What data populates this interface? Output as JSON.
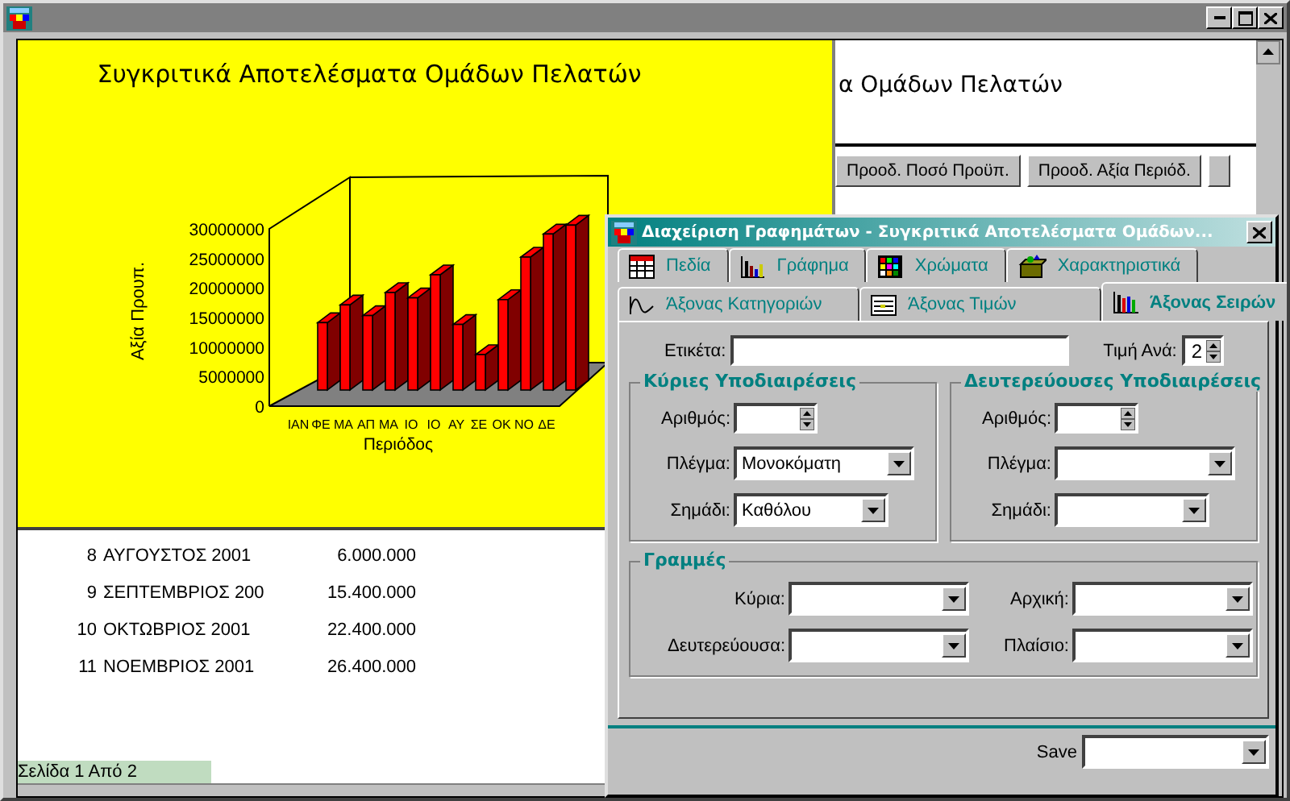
{
  "report": {
    "chart_panel": {
      "title": "Συγκριτικά Αποτελέσματα Ομάδων Πελατών",
      "x_axis_label": "Περιόδος",
      "y_axis_label": "Αξία Προυπ.",
      "x_labels": [
        "ΙΑΝ",
        "ΦΕ",
        "ΜΑ",
        "ΑΠ",
        "ΜΑ",
        "ΙΟ",
        "ΙΟ",
        "ΑΥ",
        "ΣΕ",
        "ΟΚ",
        "ΝΟ",
        "ΔΕ"
      ],
      "y_labels": [
        "30000000",
        "25000000",
        "20000000",
        "15000000",
        "10000000",
        "5000000",
        "0"
      ]
    },
    "header_text": "α Ομάδων Πελατών",
    "column_buttons": [
      "Προοδ. Ποσό Προϋπ.",
      "Προοδ. Αξία Περιόδ."
    ],
    "rows": [
      {
        "number": "8",
        "period": "ΑΥΓΟΥΣΤΟΣ 2001",
        "value": "6.000.000"
      },
      {
        "number": "9",
        "period": "ΣΕΠΤΕΜΒΡΙΟΣ 200",
        "value": "15.400.000"
      },
      {
        "number": "10",
        "period": "ΟΚΤΩΒΡΙΟΣ 2001",
        "value": "22.400.000"
      },
      {
        "number": "11",
        "period": "ΝΟΕΜΒΡΙΟΣ 2001",
        "value": "26.400.000"
      }
    ],
    "status": "Σελίδα 1 Από 2"
  },
  "dialog": {
    "title": "Διαχείριση Γραφημάτων - Συγκριτικά Αποτελέσματα Ομάδων...",
    "tab_rows": [
      [
        {
          "label": "Πεδία",
          "selected": false
        },
        {
          "label": "Γράφημα",
          "selected": false
        },
        {
          "label": "Χρώματα",
          "selected": false
        },
        {
          "label": "Χαρακτηριστικά",
          "selected": false
        }
      ],
      [
        {
          "label": "Άξονας Κατηγοριών",
          "selected": false
        },
        {
          "label": "Άξονας Τιμών",
          "selected": false
        },
        {
          "label": "Άξονας Σειρών",
          "selected": true
        }
      ]
    ],
    "label_field": {
      "label": "Ετικέτα:"
    },
    "step_field": {
      "label": "Τιμή Ανά:",
      "value": "2"
    },
    "groups": [
      {
        "title": "Κύριες Υποδιαιρέσεις",
        "number": {
          "label": "Αριθμός:"
        },
        "grid": {
          "label": "Πλέγμα:",
          "value": "Μονοκόματη"
        },
        "marker": {
          "label": "Σημάδι:",
          "value": "Καθόλου"
        }
      },
      {
        "title": "Δευτερεύουσες Υποδιαιρέσεις",
        "number": {
          "label": "Αριθμός:"
        },
        "grid": {
          "label": "Πλέγμα:"
        },
        "marker": {
          "label": "Σημάδι:"
        }
      }
    ],
    "lines": {
      "title": "Γραμμές",
      "fields": [
        {
          "label": "Κύρια:"
        },
        {
          "label": "Αρχική:"
        },
        {
          "label": "Δευτερεύουσα:"
        },
        {
          "label": "Πλαίσιο:"
        }
      ]
    },
    "save": {
      "label": "Save"
    }
  }
}
